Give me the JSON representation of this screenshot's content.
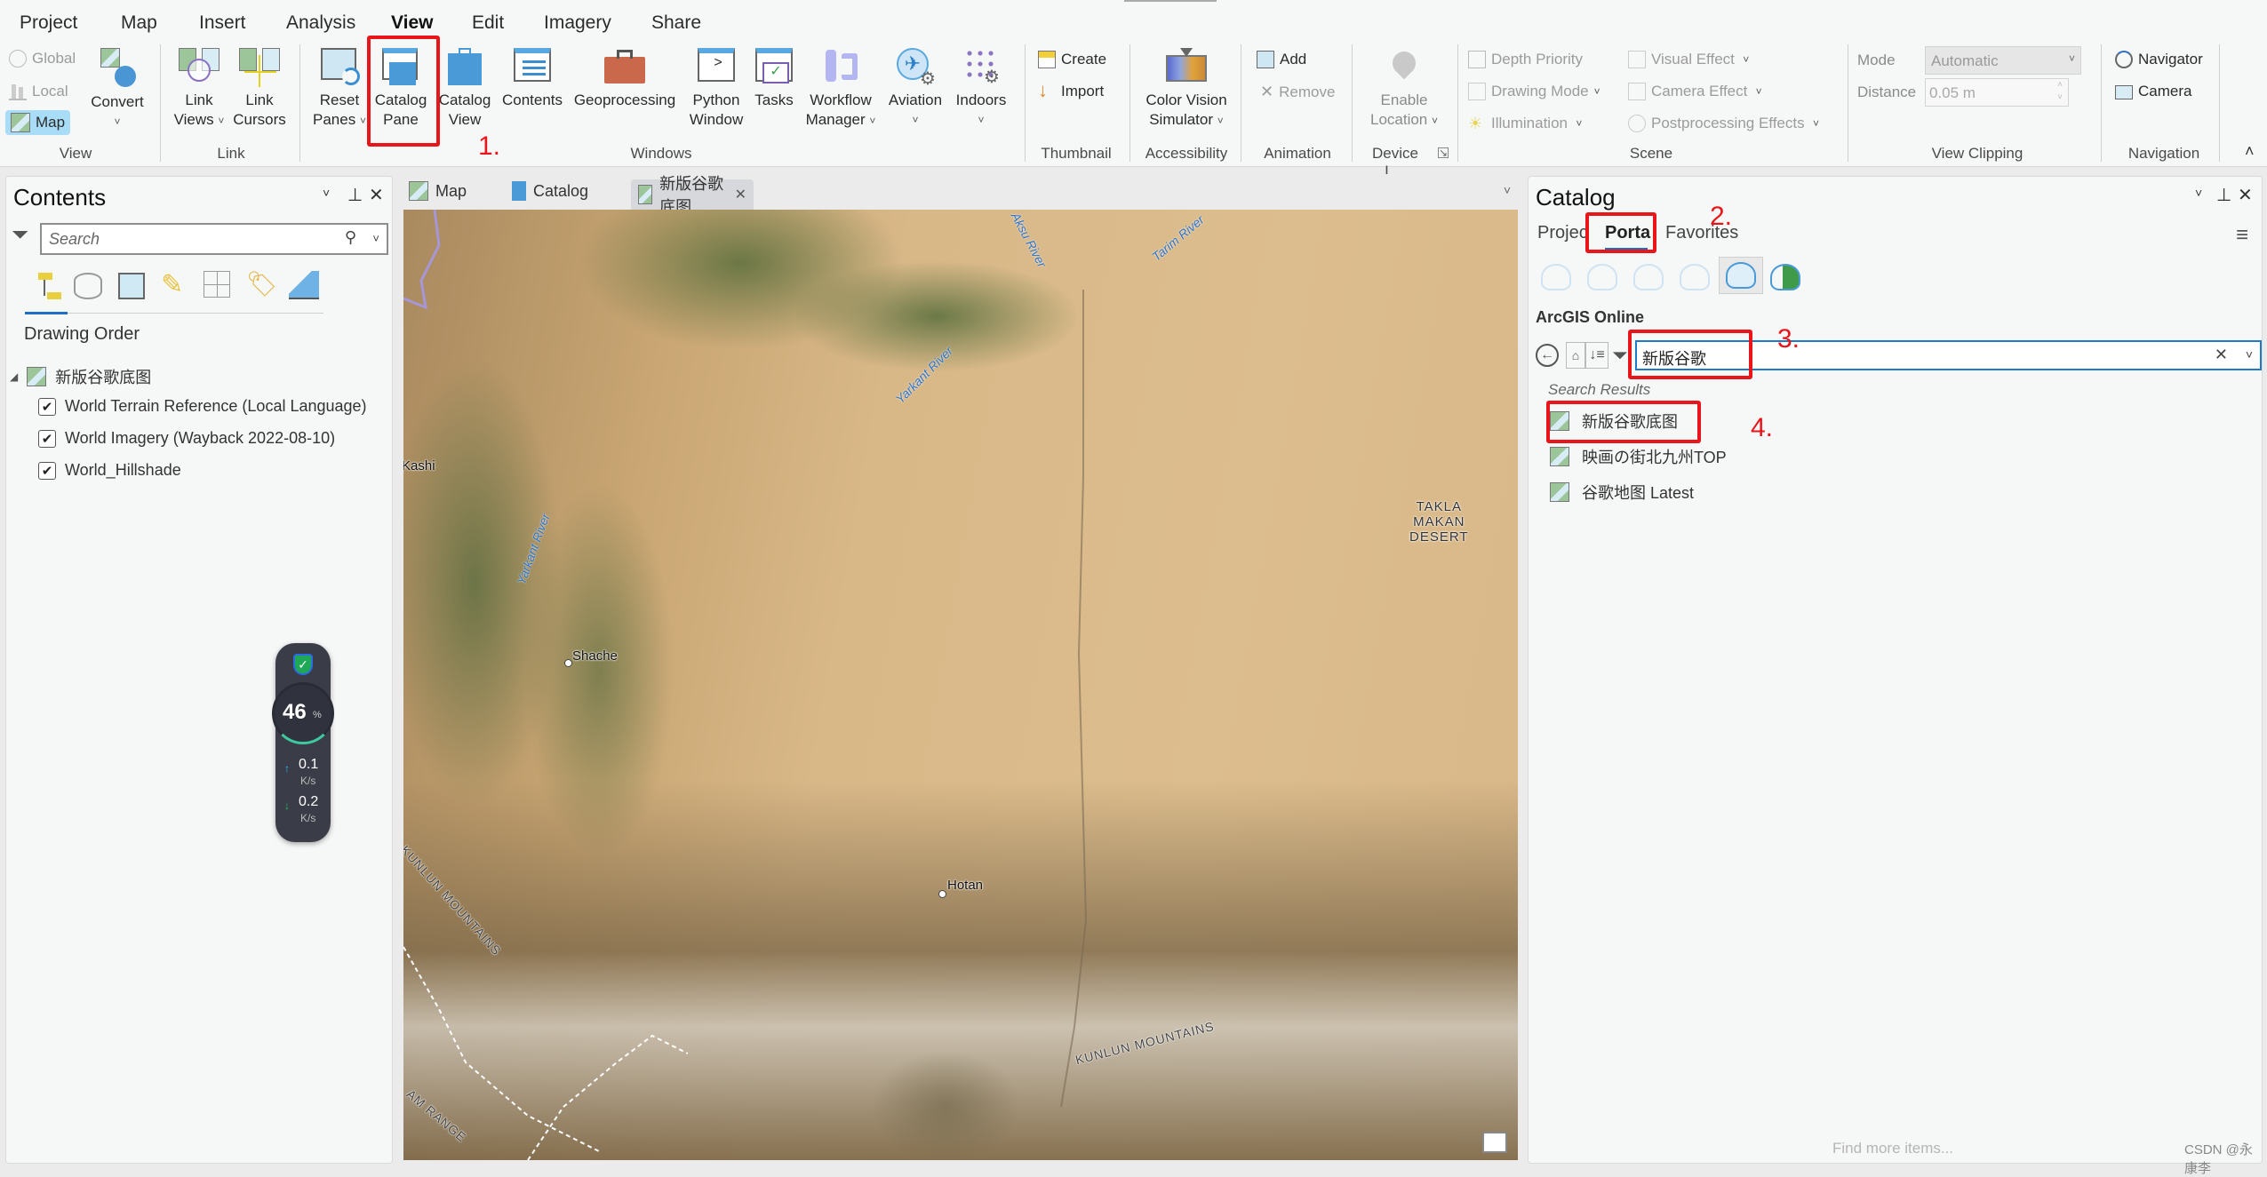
{
  "ribbon": {
    "tabs": [
      {
        "label": "Project"
      },
      {
        "label": "Map"
      },
      {
        "label": "Insert"
      },
      {
        "label": "Analysis"
      },
      {
        "label": "View",
        "active": true
      },
      {
        "label": "Edit"
      },
      {
        "label": "Imagery"
      },
      {
        "label": "Share"
      }
    ],
    "groups": {
      "view": {
        "label": "View",
        "global": "Global",
        "local": "Local",
        "map": "Map",
        "convert": "Convert"
      },
      "link": {
        "label": "Link",
        "link_views": [
          "Link",
          "Views"
        ],
        "link_cursors": [
          "Link",
          "Cursors"
        ]
      },
      "windows": {
        "label": "Windows",
        "reset_panes": [
          "Reset",
          "Panes"
        ],
        "catalog_pane": [
          "Catalog",
          "Pane"
        ],
        "catalog_view": [
          "Catalog",
          "View"
        ],
        "contents": "Contents",
        "geoprocessing": "Geoprocessing",
        "python_window": [
          "Python",
          "Window"
        ],
        "tasks": "Tasks",
        "workflow_manager": [
          "Workflow",
          "Manager"
        ],
        "aviation": "Aviation",
        "indoors": "Indoors"
      },
      "thumbnail": {
        "label": "Thumbnail",
        "create": "Create",
        "import": "Import"
      },
      "accessibility": {
        "label": "Accessibility",
        "color_vision": [
          "Color Vision",
          "Simulator"
        ]
      },
      "animation": {
        "label": "Animation",
        "add": "Add",
        "remove": "Remove"
      },
      "device_location": {
        "label": "Device L...",
        "enable_location": [
          "Enable",
          "Location"
        ]
      },
      "scene": {
        "label": "Scene",
        "depth_priority": "Depth Priority",
        "drawing_mode": "Drawing Mode",
        "illumination": "Illumination",
        "visual_effect": "Visual Effect",
        "camera_effect": "Camera Effect",
        "postprocessing": "Postprocessing Effects"
      },
      "view_clipping": {
        "label": "View Clipping",
        "mode_label": "Mode",
        "mode_value": "Automatic",
        "distance_label": "Distance",
        "distance_value": "0.05  m"
      },
      "navigation": {
        "label": "Navigation",
        "navigator": "Navigator",
        "camera": "Camera"
      }
    }
  },
  "contents": {
    "title": "Contents",
    "search_placeholder": "Search",
    "section": "Drawing Order",
    "map_name": "新版谷歌底图",
    "layers": [
      {
        "name": "World Terrain Reference (Local Language)",
        "checked": true
      },
      {
        "name": "World Imagery (Wayback 2022-08-10)",
        "checked": true
      },
      {
        "name": "World_Hillshade",
        "checked": true
      }
    ]
  },
  "network_widget": {
    "percent": "46",
    "percent_sign": "%",
    "upload": "0.1",
    "download": "0.2",
    "unit": "K/s"
  },
  "map_view": {
    "tabs": [
      {
        "label": "Map"
      },
      {
        "label": "Catalog"
      },
      {
        "label": "新版谷歌底图",
        "active": true
      }
    ],
    "labels": {
      "kashi": "Kashi",
      "shache": "Shache",
      "hotan": "Hotan",
      "takla": [
        "TAKLA",
        "MAKAN",
        "DESERT"
      ],
      "aksu": "Aksu River",
      "tarim": "Tarim River",
      "yarkant1": "Yarkant River",
      "yarkant2": "Yarkant River",
      "kunlun1": "KUNLUN MOUNTAINS",
      "kunlun2": "KUNLUN MOUNTAINS",
      "karakoram": "AM RANGE"
    }
  },
  "catalog": {
    "title": "Catalog",
    "tabs": [
      {
        "label": "Project"
      },
      {
        "label": "Portal",
        "active": true
      },
      {
        "label": "Favorites"
      }
    ],
    "tab_display": [
      "Projec",
      "Porta",
      "Favorites"
    ],
    "source": "ArcGIS Online",
    "search_value": "新版谷歌",
    "results_header": "Search Results",
    "results": [
      {
        "name": "新版谷歌底图"
      },
      {
        "name": "映画の街北九州TOP"
      },
      {
        "name": "谷歌地图 Latest"
      }
    ],
    "find_more": "Find more items..."
  },
  "annotations": [
    "1.",
    "2.",
    "3.",
    "4."
  ],
  "watermark": "CSDN @永康李"
}
